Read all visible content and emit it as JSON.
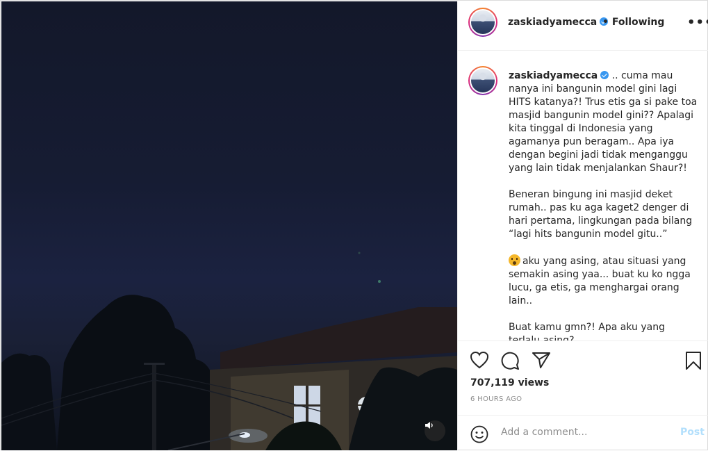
{
  "post": {
    "username": "zaskiadyamecca",
    "follow_separator": "•",
    "follow_status": "Following",
    "more_label": "•••"
  },
  "caption": {
    "username": "zaskiadyamecca",
    "para1": ".. cuma mau nanya ini bangunin model gini lagi HITS katanya?! Trus etis ga si pake toa masjid bangunin model gini?? Apalagi kita tinggal di Indonesia yang agamanya pun beragam.. Apa iya dengan begini jadi tidak menganggu yang lain tidak menjalankan Shaur?!",
    "para2": "Beneran bingung ini masjid deket rumah.. pas ku aga kaget2 denger di hari pertama, lingkungan pada bilang “lagi hits bangunin model gitu..”",
    "para3": "aku yang asing, atau situasi yang semakin asing yaa... buat ku ko ngga lucu, ga etis, ga menghargai orang lain..",
    "para4": "Buat kamu gmn?! Apa aku yang terlalu asing?"
  },
  "icons": {
    "like": "heart-icon",
    "comment": "comment-icon",
    "share": "paper-plane-icon",
    "save": "bookmark-icon",
    "emoji": "smiley-icon",
    "mute": "speaker-icon",
    "verified": "verified-badge-icon"
  },
  "stats": {
    "views": "707,119 views",
    "time_ago": "6 HOURS AGO"
  },
  "comment_box": {
    "placeholder": "Add a comment...",
    "post_label": "Post"
  },
  "colors": {
    "verified": "#3897f0",
    "post_disabled": "#b2dffc",
    "muted_text": "#8e8e8e"
  }
}
